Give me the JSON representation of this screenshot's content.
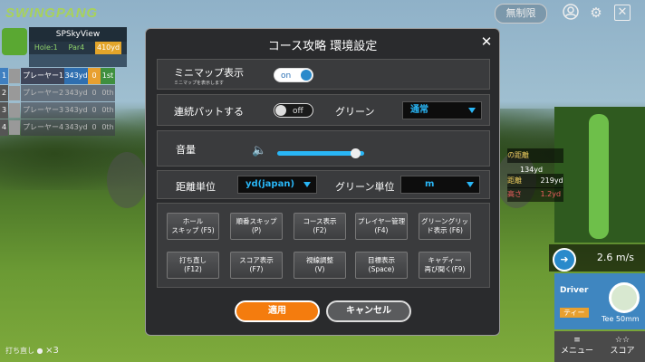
{
  "app": {
    "logo_prefix": "SWING",
    "logo_suffix": "PANG",
    "unlimited_label": "無制限"
  },
  "scoreboard": {
    "course": "SPSkyView",
    "hole": "Hole:1",
    "par": "Par4",
    "distance": "410yd",
    "players": [
      {
        "num": "1",
        "name": "プレーヤー1",
        "yards": "343yd",
        "score": "0",
        "rank": "1st"
      },
      {
        "num": "2",
        "name": "プレーヤー2",
        "yards": "343yd",
        "score": "0",
        "rank": "0th"
      },
      {
        "num": "3",
        "name": "プレーヤー3",
        "yards": "343yd",
        "score": "0",
        "rank": "0th"
      },
      {
        "num": "4",
        "name": "プレーヤー4",
        "yards": "343yd",
        "score": "0",
        "rank": "0th"
      }
    ]
  },
  "right_panel": {
    "pin_label": "の距離",
    "pin_value": "134yd",
    "dist_label": "距離",
    "dist_value": "219yd",
    "height_label": "高さ",
    "height_value": "1.2yd",
    "wind": "2.6 m/s",
    "club": "Driver",
    "tee_label": "ティー",
    "tee": "Tee",
    "tee_size": "50mm",
    "menu_label": "メニュー",
    "score_label": "スコア"
  },
  "retry": {
    "label": "打ち直し",
    "count": "×3"
  },
  "dialog": {
    "title": "コース攻略 環境設定",
    "minimap": {
      "label": "ミニマップ表示",
      "sub": "ミニマップを表示します",
      "toggle": "on"
    },
    "putt": {
      "label": "連続パットする",
      "toggle": "off",
      "green_label": "グリーン",
      "green_value": "通常"
    },
    "volume": {
      "label": "音量",
      "level": 0.9
    },
    "units": {
      "distance_label": "距離単位",
      "distance_value": "yd(japan)",
      "green_label": "グリーン単位",
      "green_value": "m"
    },
    "buttons": [
      "ホール\nスキップ (F5)",
      "順番スキップ\n(P)",
      "コース表示\n(F2)",
      "プレイヤー管理\n(F4)",
      "グリーングリッ\nド表示 (F6)",
      "打ち直し\n(F12)",
      "スコア表示\n(F7)",
      "視線調整\n(V)",
      "目標表示\n(Space)",
      "キャディー\n再び聞く(F9)"
    ],
    "apply": "適用",
    "cancel": "キャンセル"
  }
}
